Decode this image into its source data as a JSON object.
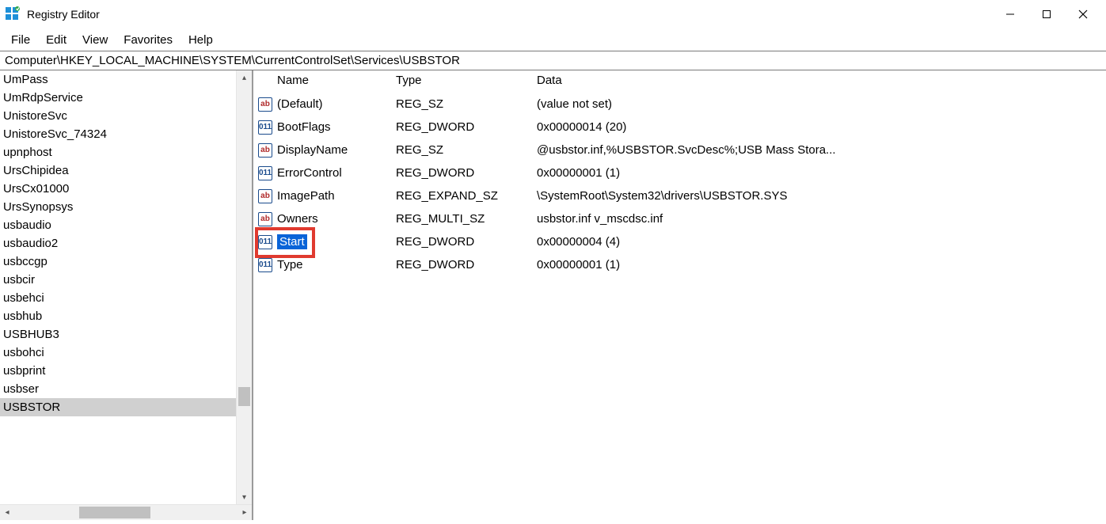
{
  "window": {
    "title": "Registry Editor"
  },
  "menu": {
    "file": "File",
    "edit": "Edit",
    "view": "View",
    "favorites": "Favorites",
    "help": "Help"
  },
  "address": "Computer\\HKEY_LOCAL_MACHINE\\SYSTEM\\CurrentControlSet\\Services\\USBSTOR",
  "tree": {
    "items": [
      "UmPass",
      "UmRdpService",
      "UnistoreSvc",
      "UnistoreSvc_74324",
      "upnphost",
      "UrsChipidea",
      "UrsCx01000",
      "UrsSynopsys",
      "usbaudio",
      "usbaudio2",
      "usbccgp",
      "usbcir",
      "usbehci",
      "usbhub",
      "USBHUB3",
      "usbohci",
      "usbprint",
      "usbser",
      "USBSTOR"
    ],
    "selected_index": 18
  },
  "list": {
    "columns": {
      "name": "Name",
      "type": "Type",
      "data": "Data"
    },
    "rows": [
      {
        "icon": "sz",
        "name": "(Default)",
        "type": "REG_SZ",
        "data": "(value not set)"
      },
      {
        "icon": "bin",
        "name": "BootFlags",
        "type": "REG_DWORD",
        "data": "0x00000014 (20)"
      },
      {
        "icon": "sz",
        "name": "DisplayName",
        "type": "REG_SZ",
        "data": "@usbstor.inf,%USBSTOR.SvcDesc%;USB Mass Stora..."
      },
      {
        "icon": "bin",
        "name": "ErrorControl",
        "type": "REG_DWORD",
        "data": "0x00000001 (1)"
      },
      {
        "icon": "sz",
        "name": "ImagePath",
        "type": "REG_EXPAND_SZ",
        "data": "\\SystemRoot\\System32\\drivers\\USBSTOR.SYS"
      },
      {
        "icon": "sz",
        "name": "Owners",
        "type": "REG_MULTI_SZ",
        "data": "usbstor.inf v_mscdsc.inf"
      },
      {
        "icon": "bin",
        "name": "Start",
        "type": "REG_DWORD",
        "data": "0x00000004 (4)"
      },
      {
        "icon": "bin",
        "name": "Type",
        "type": "REG_DWORD",
        "data": "0x00000001 (1)"
      }
    ],
    "selected_index": 6
  }
}
